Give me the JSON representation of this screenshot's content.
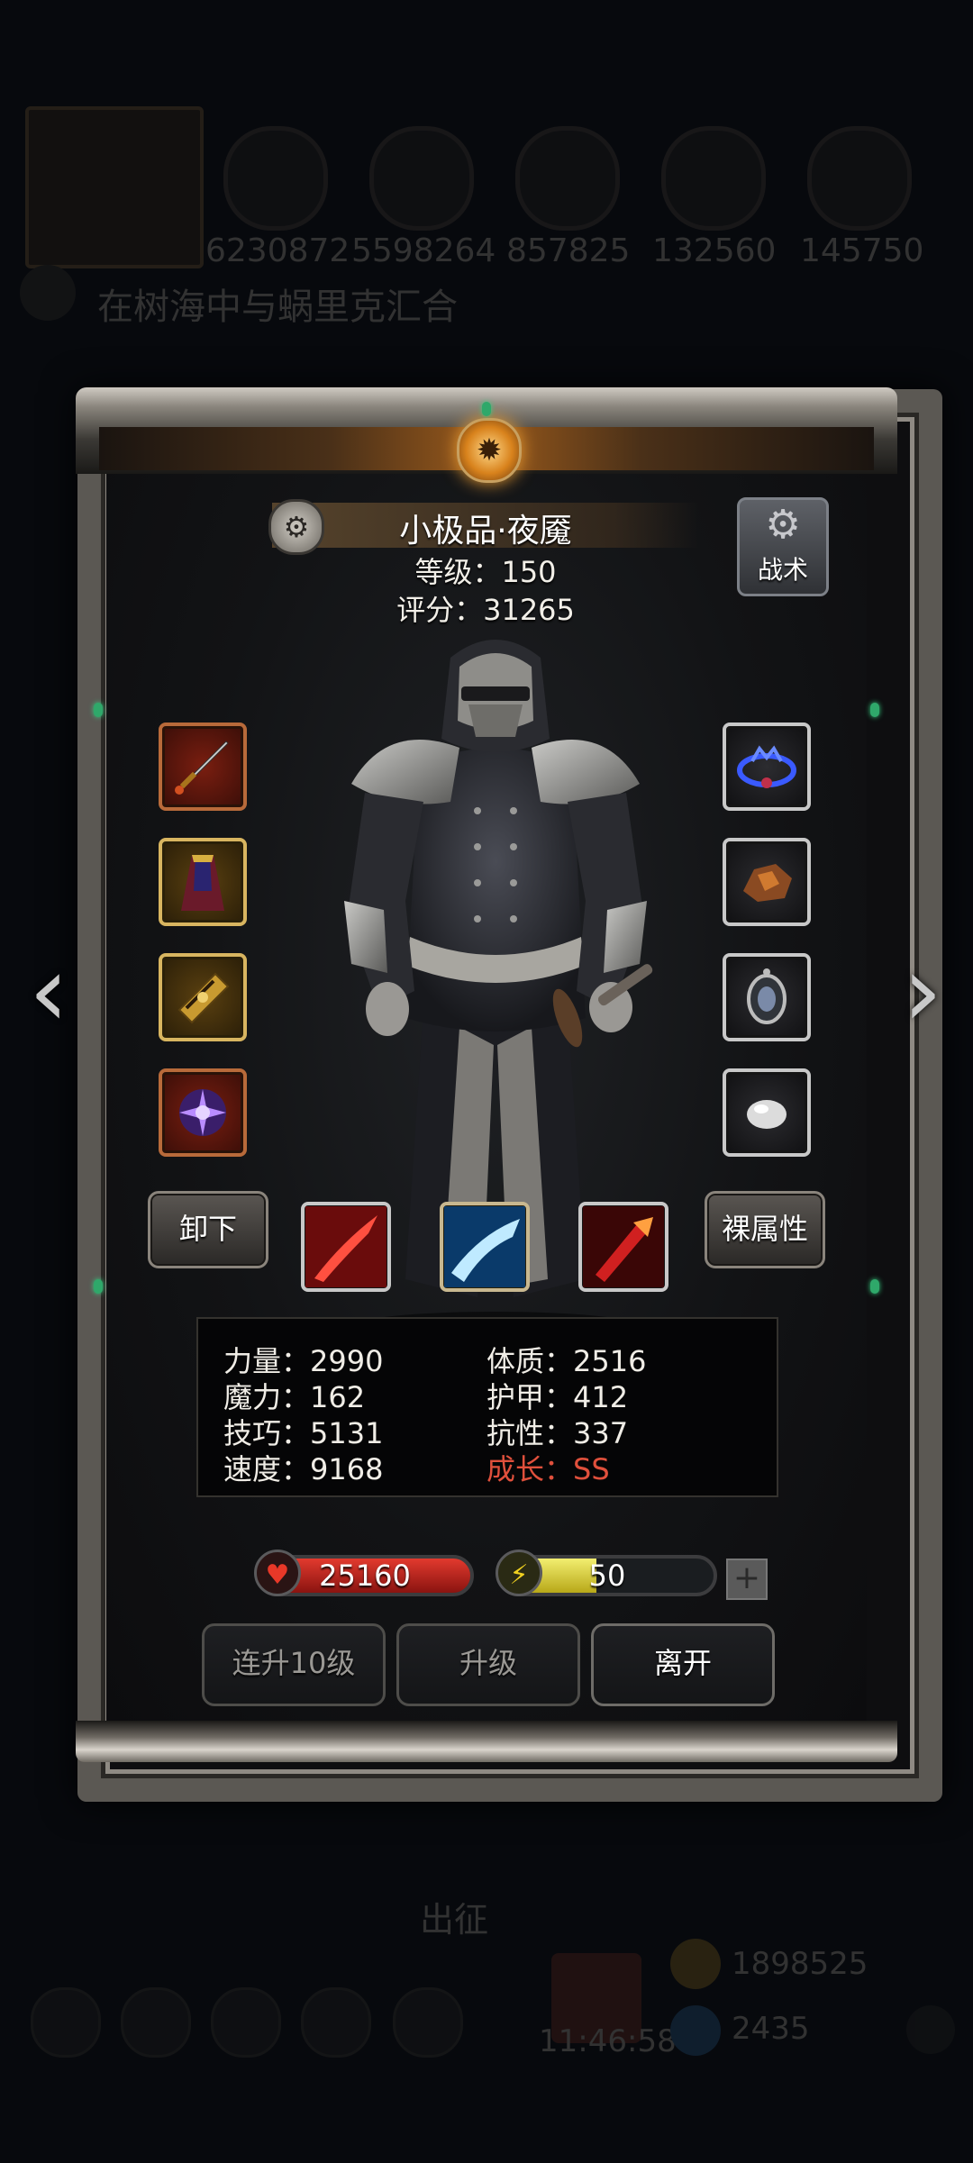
{
  "background": {
    "resources": [
      "6230872",
      "5598264",
      "857825",
      "132560",
      "145750"
    ],
    "quest": "在树海中与蜗里克汇合",
    "depart_label": "出征",
    "time": "11:46:58",
    "gold": "1898525",
    "gems": "2435"
  },
  "hero": {
    "name": "小极品·夜魇",
    "level": "等级：150",
    "score": "评分：31265",
    "tactics_label": "战术"
  },
  "equipment": {
    "left": [
      "sword",
      "cloak",
      "golden-armor",
      "purple-orb"
    ],
    "right": [
      "blue-tiara",
      "ore",
      "amulet",
      "white-stone"
    ]
  },
  "actions": {
    "unequip": "卸下",
    "base_attributes": "裸属性",
    "level_up_10": "连升10级",
    "level_up": "升级",
    "leave": "离开"
  },
  "skills": [
    "red-slash",
    "blue-slash",
    "red-strike"
  ],
  "stats": {
    "strength": "力量：2990",
    "magic": "魔力：162",
    "skill": "技巧：5131",
    "speed": "速度：9168",
    "constitution": "体质：2516",
    "armor": "护甲：412",
    "resistance": "抗性：337",
    "growth": "成长：SS"
  },
  "bars": {
    "hp": "25160",
    "energy": "50",
    "energy_fill": 0.45
  },
  "colors": {
    "growth": "#e0503c",
    "hp": "#d22a20",
    "energy": "#e8e050"
  }
}
